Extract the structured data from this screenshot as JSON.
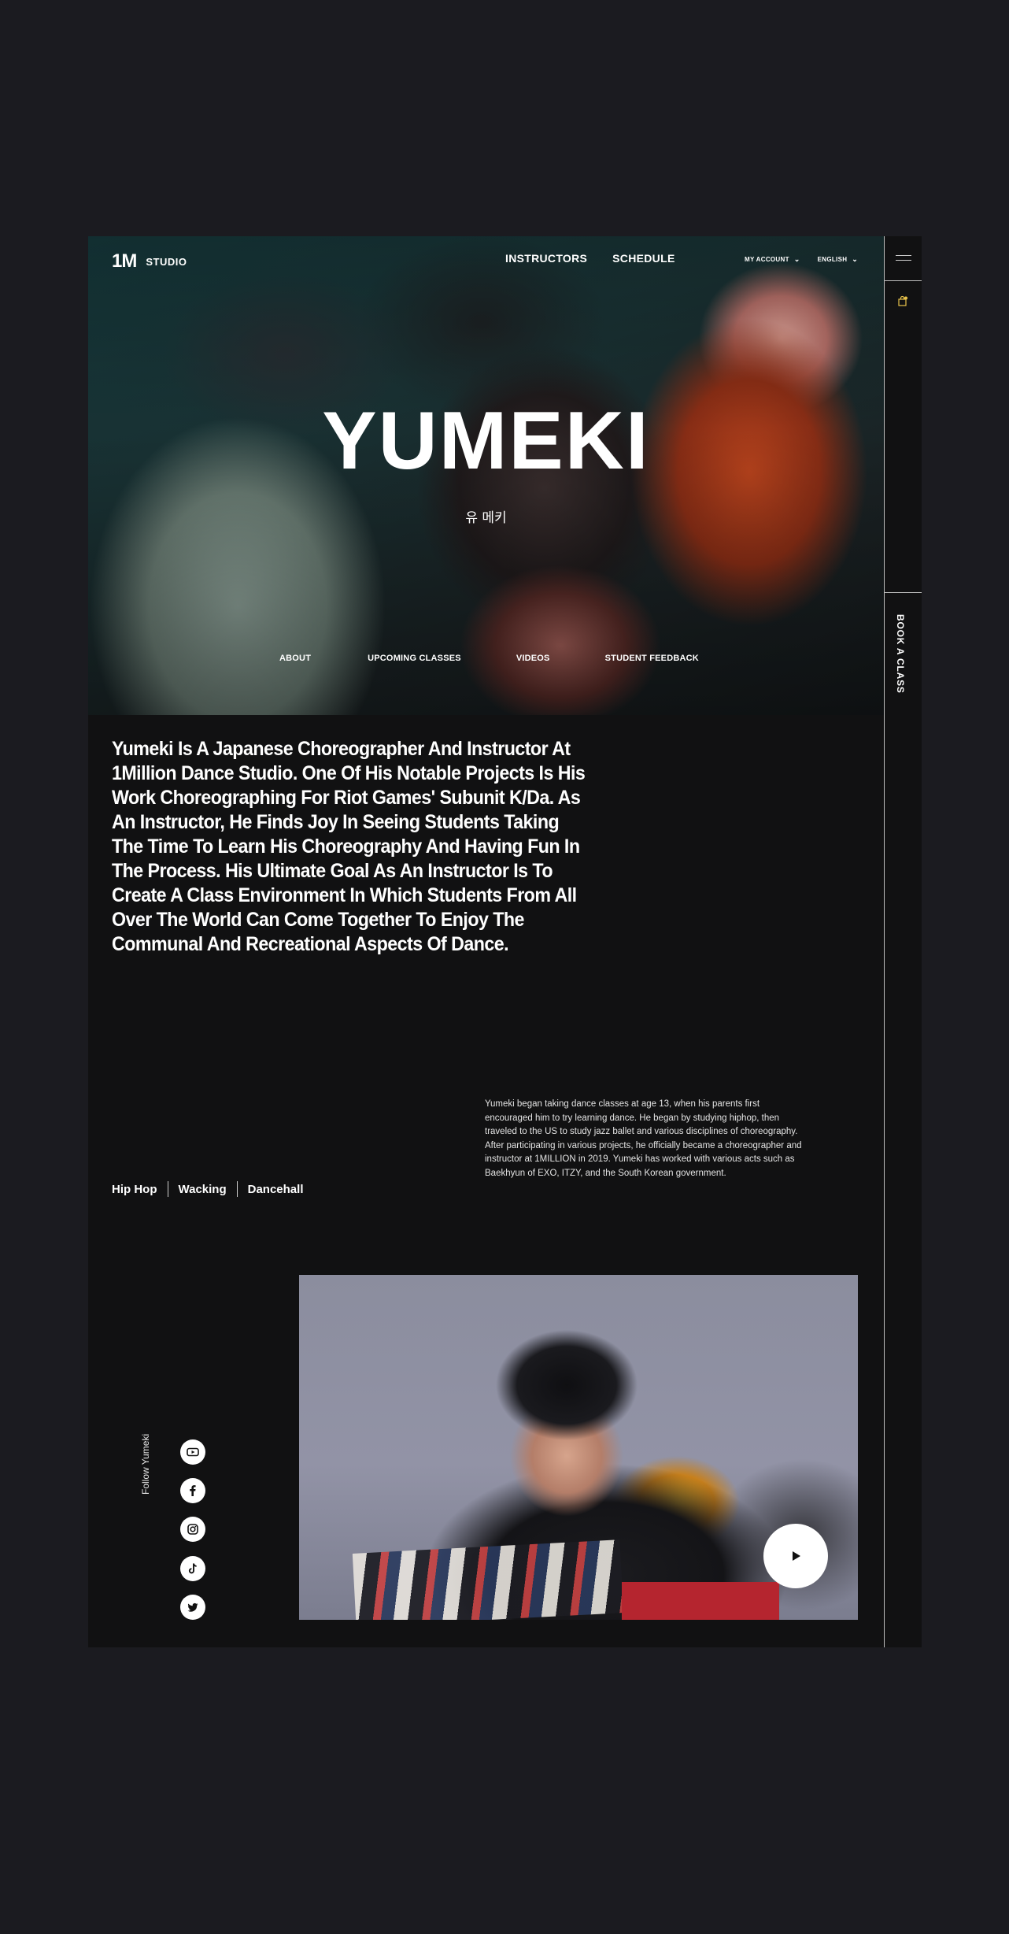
{
  "header": {
    "logo_mark": "1M",
    "logo_text": "STUDIO",
    "nav": [
      "INSTRUCTORS",
      "SCHEDULE"
    ],
    "account_label": "MY ACCOUNT",
    "language_label": "ENGLISH"
  },
  "hero": {
    "title": "YUMEKI",
    "subtitle": "유 메키",
    "tabs": [
      "ABOUT",
      "UPCOMING CLASSES",
      "VIDEOS",
      "STUDENT FEEDBACK"
    ]
  },
  "side_rail": {
    "book_label": "BOOK A CLASS",
    "icons": [
      "menu-icon",
      "bag-icon"
    ]
  },
  "bio": {
    "lead": "Yumeki Is A Japanese Choreographer And Instructor At 1Million Dance Studio. One Of His Notable Projects Is His Work Choreographing For Riot Games' Subunit K/Da. As An Instructor, He Finds Joy In Seeing Students Taking The Time To Learn His Choreography And Having Fun In The Process. His Ultimate Goal As An Instructor Is To Create A Class Environment In Which Students From All Over The World Can Come Together To Enjoy The Communal And Recreational Aspects Of Dance.",
    "body": "Yumeki began taking dance classes at age 13, when his parents first encouraged him to try learning dance. He began by studying hiphop, then traveled to the US to study jazz ballet and various disciplines of choreography. After participating in various projects, he officially became a choreographer and instructor at 1MILLION in 2019. Yumeki has worked with various acts such as Baekhyun of EXO, ITZY, and the South Korean government.",
    "genres": [
      "Hip Hop",
      "Wacking",
      "Dancehall"
    ]
  },
  "social": {
    "follow_label": "Follow Yumeki",
    "icons": [
      "youtube-icon",
      "facebook-icon",
      "instagram-icon",
      "tiktok-icon",
      "twitter-icon"
    ]
  },
  "colors": {
    "page_background": "#1b1b20",
    "panel_background": "#111112",
    "text": "#ffffff"
  }
}
